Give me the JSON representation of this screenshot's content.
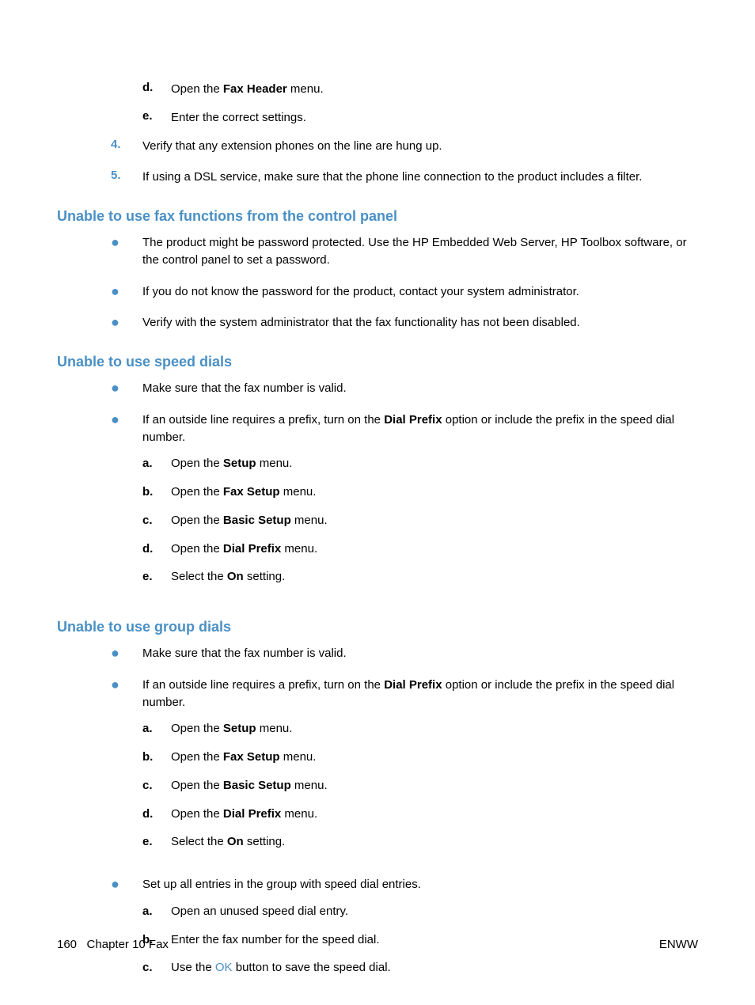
{
  "initial_alpha": [
    {
      "m": "d.",
      "pre": "Open the ",
      "bold": "Fax Header",
      "post": " menu."
    },
    {
      "m": "e.",
      "pre": "Enter the correct settings.",
      "bold": "",
      "post": ""
    }
  ],
  "initial_num": [
    {
      "m": "4.",
      "text": "Verify that any extension phones on the line are hung up."
    },
    {
      "m": "5.",
      "text": "If using a DSL service, make sure that the phone line connection to the product includes a filter."
    }
  ],
  "sec1": {
    "title": "Unable to use fax functions from the control panel",
    "bullets": [
      "The product might be password protected. Use the HP Embedded Web Server, HP Toolbox software, or the control panel to set a password.",
      "If you do not know the password for the product, contact your system administrator.",
      "Verify with the system administrator that the fax functionality has not been disabled."
    ]
  },
  "sec2": {
    "title": "Unable to use speed dials",
    "bullet1": "Make sure that the fax number is valid.",
    "bullet2_pre": "If an outside line requires a prefix, turn on the ",
    "bullet2_bold": "Dial Prefix",
    "bullet2_post": " option or include the prefix in the speed dial number.",
    "alpha": [
      {
        "m": "a.",
        "pre": "Open the ",
        "bold": "Setup",
        "post": " menu."
      },
      {
        "m": "b.",
        "pre": "Open the ",
        "bold": "Fax Setup",
        "post": " menu."
      },
      {
        "m": "c.",
        "pre": "Open the ",
        "bold": "Basic Setup",
        "post": " menu."
      },
      {
        "m": "d.",
        "pre": "Open the ",
        "bold": "Dial Prefix",
        "post": " menu."
      },
      {
        "m": "e.",
        "pre": "Select the ",
        "bold": "On",
        "post": " setting."
      }
    ]
  },
  "sec3": {
    "title": "Unable to use group dials",
    "bullet1": "Make sure that the fax number is valid.",
    "bullet2_pre": "If an outside line requires a prefix, turn on the ",
    "bullet2_bold": "Dial Prefix",
    "bullet2_post": " option or include the prefix in the speed dial number.",
    "alpha2": [
      {
        "m": "a.",
        "pre": "Open the ",
        "bold": "Setup",
        "post": " menu."
      },
      {
        "m": "b.",
        "pre": "Open the ",
        "bold": "Fax Setup",
        "post": " menu."
      },
      {
        "m": "c.",
        "pre": "Open the ",
        "bold": "Basic Setup",
        "post": " menu."
      },
      {
        "m": "d.",
        "pre": "Open the ",
        "bold": "Dial Prefix",
        "post": " menu."
      },
      {
        "m": "e.",
        "pre": "Select the ",
        "bold": "On",
        "post": " setting."
      }
    ],
    "bullet3": "Set up all entries in the group with speed dial entries.",
    "alpha3": [
      {
        "m": "a.",
        "text": "Open an unused speed dial entry."
      },
      {
        "m": "b.",
        "text": "Enter the fax number for the speed dial."
      }
    ],
    "alpha3c_m": "c.",
    "alpha3c_pre": "Use the ",
    "alpha3c_ok": "OK",
    "alpha3c_post": " button to save the speed dial."
  },
  "footer": {
    "page": "160",
    "chapter": "Chapter 10   Fax",
    "right": "ENWW"
  }
}
